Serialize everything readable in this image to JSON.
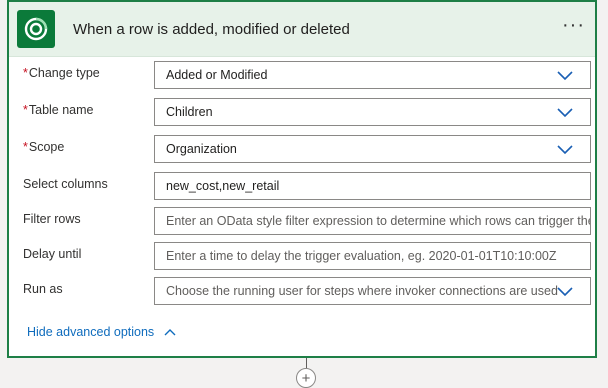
{
  "trigger": {
    "title": "When a row is added, modified or deleted",
    "more_label": "···",
    "icon": "dataverse-icon",
    "accent_color": "#0b7a3a",
    "border_color": "#1e7f46"
  },
  "fields": [
    {
      "label": "Change type",
      "required": "*",
      "value": "Added or Modified",
      "type": "dropdown"
    },
    {
      "label": "Table name",
      "required": "*",
      "value": "Children",
      "type": "dropdown"
    },
    {
      "label": "Scope",
      "required": "*",
      "value": "Organization",
      "type": "dropdown"
    },
    {
      "label": "Select columns",
      "value": "new_cost,new_retail",
      "type": "text"
    },
    {
      "label": "Filter rows",
      "placeholder": "Enter an OData style filter expression to determine which rows can trigger the",
      "type": "text"
    },
    {
      "label": "Delay until",
      "placeholder": "Enter a time to delay the trigger evaluation, eg. 2020-01-01T10:10:00Z",
      "type": "text"
    },
    {
      "label": "Run as",
      "placeholder": "Choose the running user for steps where invoker connections are used",
      "type": "dropdown"
    }
  ],
  "advanced_toggle": "Hide advanced options",
  "add_step": "+"
}
